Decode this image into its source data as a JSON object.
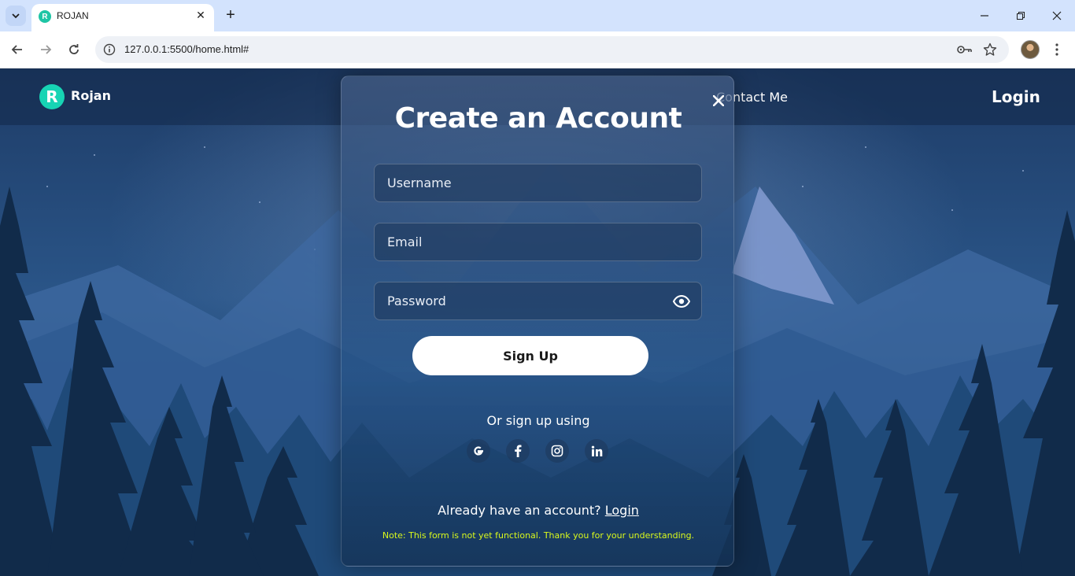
{
  "browser": {
    "tab_title": "ROJAN",
    "tab_favicon_letter": "R",
    "url": "127.0.0.1:5500/home.html#",
    "new_tab_glyph": "+",
    "tab_close_glyph": "✕",
    "minimize_glyph": "—",
    "maximize_glyph": "❐",
    "close_glyph": "✕"
  },
  "site": {
    "logo_letter": "R",
    "logo_text": "Rojan",
    "nav": [
      "Contact Me"
    ],
    "login": "Login",
    "accent_color": "#17d4b4"
  },
  "modal": {
    "title": "Create an Account",
    "close_glyph": "✕",
    "username_placeholder": "Username",
    "email_placeholder": "Email",
    "password_placeholder": "Password",
    "signup_label": "Sign Up",
    "or_text": "Or sign up using",
    "social": [
      "google-icon",
      "facebook-icon",
      "instagram-icon",
      "linkedin-icon"
    ],
    "already_text": "Already have an account?",
    "login_link": "Login",
    "note": "Note: This form is not yet functional. Thank you for your understanding.",
    "note_color": "#d9f81c"
  }
}
